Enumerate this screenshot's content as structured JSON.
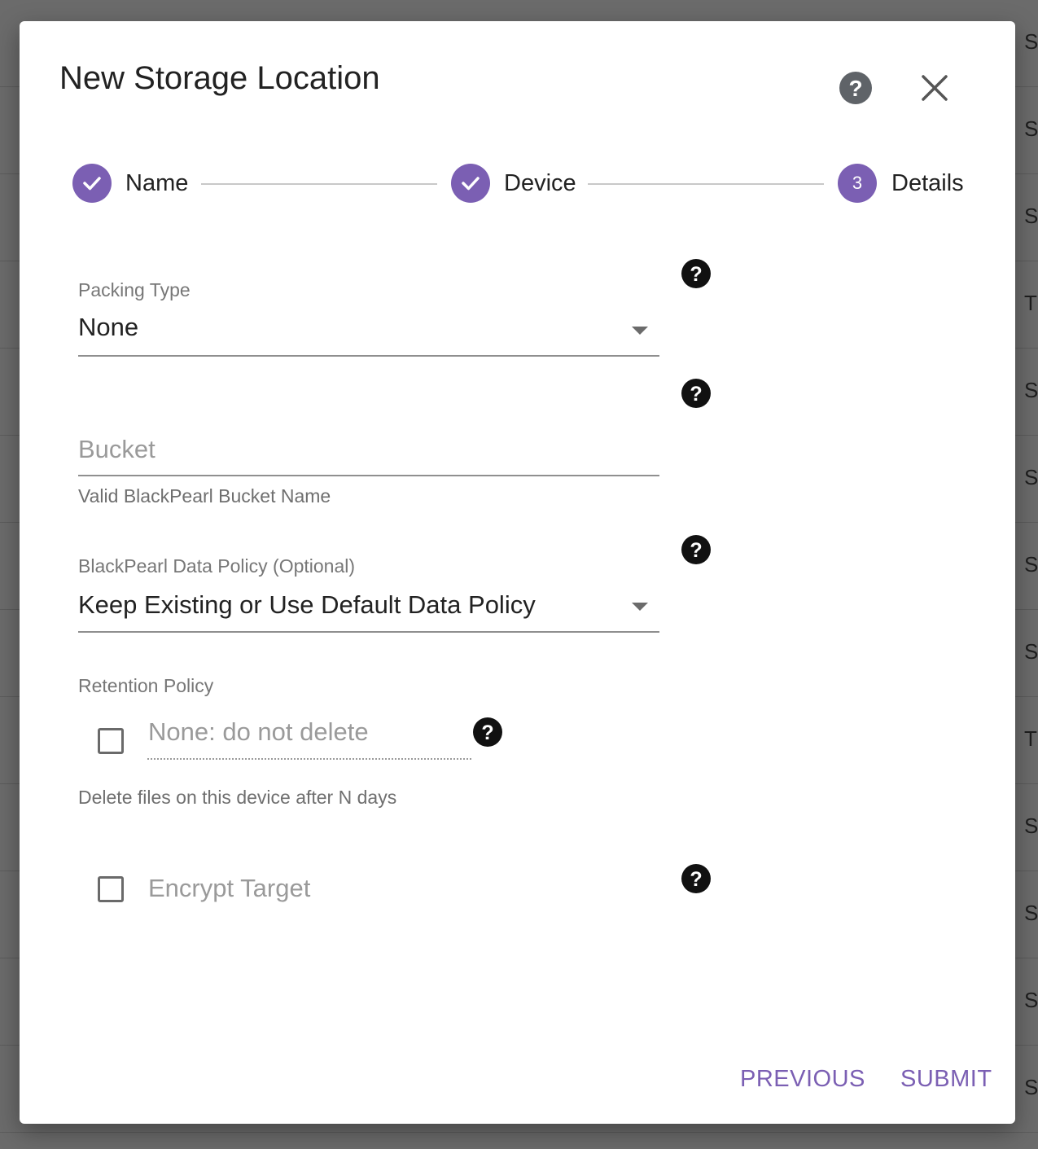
{
  "background": {
    "row_letters": [
      "S",
      "S",
      "S",
      "T",
      "S",
      "S",
      "S",
      "S",
      "T",
      "S",
      "S",
      "S",
      "S"
    ]
  },
  "dialog": {
    "title": "New Storage Location",
    "help_icon": "help-circle-icon",
    "close_icon": "close-icon"
  },
  "stepper": {
    "steps": [
      {
        "label": "Name",
        "state": "completed",
        "icon": "check-icon"
      },
      {
        "label": "Device",
        "state": "completed",
        "icon": "check-icon"
      },
      {
        "label": "Details",
        "state": "active",
        "number": "3"
      }
    ],
    "accent_color": "#7b5fb3"
  },
  "form": {
    "packing_type": {
      "label": "Packing Type",
      "value": "None"
    },
    "bucket": {
      "placeholder": "Bucket",
      "helper": "Valid BlackPearl Bucket Name"
    },
    "data_policy": {
      "label": "BlackPearl Data Policy (Optional)",
      "value": "Keep Existing or Use Default Data Policy"
    },
    "retention": {
      "label": "Retention Policy",
      "placeholder": "None: do not delete",
      "helper": "Delete files on this device after N days",
      "checked": false
    },
    "encrypt": {
      "label": "Encrypt Target",
      "checked": false
    }
  },
  "actions": {
    "previous": "PREVIOUS",
    "submit": "SUBMIT"
  }
}
